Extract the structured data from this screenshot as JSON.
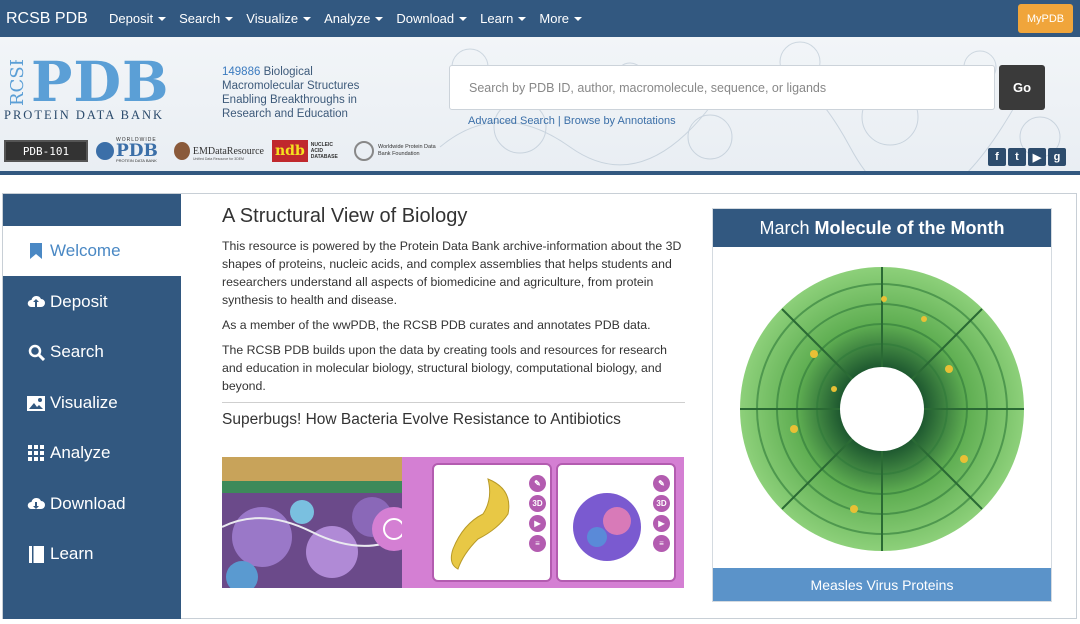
{
  "nav": {
    "brand": "RCSB PDB",
    "items": [
      "Deposit",
      "Search",
      "Visualize",
      "Analyze",
      "Download",
      "Learn",
      "More"
    ],
    "mypdb": "MyPDB"
  },
  "header": {
    "logo_side": "RCSB",
    "logo_main": "PDB",
    "logo_sub": "PROTEIN DATA BANK",
    "count": "149886",
    "tagline_rest": " Biological Macromolecular Structures Enabling Breakthroughs in Research and Education",
    "search_placeholder": "Search by PDB ID, author, macromolecule, sequence, or ligands",
    "go_label": "Go",
    "advanced_search": "Advanced Search",
    "link_separator": "|",
    "browse_annotations": "Browse by Annotations",
    "partners": {
      "pdb101": "PDB-101",
      "wwpdb_small": "WORLDWIDE",
      "wwpdb": "PDB",
      "wwpdb_sub": "PROTEIN DATA BANK",
      "emdata": "EMDataResource",
      "emdata_sub": "Unified Data Resource for 3DEM",
      "ndb": "ndb",
      "ndb_sub": "NUCLEIC ACID DATABASE",
      "foundation": "Worldwide Protein Data Bank Foundation"
    },
    "social": [
      "f",
      "t",
      "▶",
      "g"
    ]
  },
  "sidebar": {
    "items": [
      {
        "label": "Welcome",
        "icon": "bookmark-icon"
      },
      {
        "label": "Deposit",
        "icon": "cloud-upload-icon"
      },
      {
        "label": "Search",
        "icon": "search-icon"
      },
      {
        "label": "Visualize",
        "icon": "image-icon"
      },
      {
        "label": "Analyze",
        "icon": "grid-icon"
      },
      {
        "label": "Download",
        "icon": "cloud-download-icon"
      },
      {
        "label": "Learn",
        "icon": "book-icon"
      }
    ]
  },
  "main": {
    "title": "A Structural View of Biology",
    "p1": "This resource is powered by the Protein Data Bank archive-information about the 3D shapes of proteins, nucleic acids, and complex assemblies that helps students and researchers understand all aspects of biomedicine and agriculture, from protein synthesis to health and disease.",
    "p2": "As a member of the wwPDB, the RCSB PDB curates and annotates PDB data.",
    "p3": "The RCSB PDB builds upon the data by creating tools and resources for research and education in molecular biology, structural biology, computational biology, and beyond.",
    "feature_title": "Superbugs! How Bacteria Evolve Resistance to Antibiotics",
    "card_icons": [
      "✎",
      "3D",
      "▶",
      "≡"
    ]
  },
  "motm": {
    "month": "March",
    "label": "Molecule of the Month",
    "caption": "Measles Virus Proteins"
  },
  "colors": {
    "nav_bg": "#325880",
    "accent": "#5b93c9",
    "mypdb": "#f0a53b",
    "feature": "#d47fd3"
  }
}
